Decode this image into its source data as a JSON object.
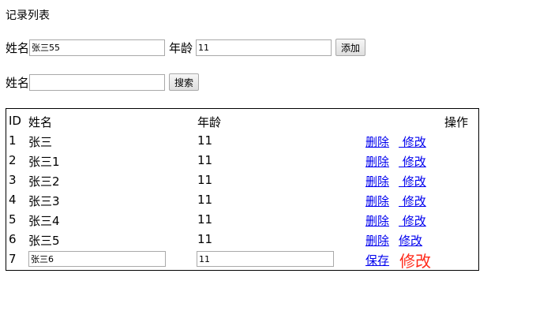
{
  "page_title": "记录列表",
  "add_form": {
    "name_label": "姓名",
    "name_value": "张三55",
    "age_label": "年龄",
    "age_value": "11",
    "add_button": "添加"
  },
  "search_form": {
    "name_label": "姓名",
    "name_value": "",
    "search_button": "搜索"
  },
  "table": {
    "headers": {
      "id": "ID",
      "name": "姓名",
      "age": "年龄",
      "op": "操作"
    },
    "rows": [
      {
        "id": "1",
        "name": "张三",
        "age": "11",
        "delete": "删除",
        "modify": " 修改"
      },
      {
        "id": "2",
        "name": "张三1",
        "age": "11",
        "delete": "删除",
        "modify": " 修改"
      },
      {
        "id": "3",
        "name": "张三2",
        "age": "11",
        "delete": "删除",
        "modify": " 修改"
      },
      {
        "id": "4",
        "name": "张三3",
        "age": "11",
        "delete": "删除",
        "modify": " 修改"
      },
      {
        "id": "5",
        "name": "张三4",
        "age": "11",
        "delete": "删除",
        "modify": " 修改"
      },
      {
        "id": "6",
        "name": "张三5",
        "age": "11",
        "delete": "删除",
        "modify": "修改"
      }
    ],
    "edit_row": {
      "id": "7",
      "name_value": "张三6",
      "age_value": "11",
      "save": "保存",
      "modify": "修改",
      "modify_color": "#ff2a1a"
    }
  },
  "colors": {
    "link": "#0000ee"
  }
}
